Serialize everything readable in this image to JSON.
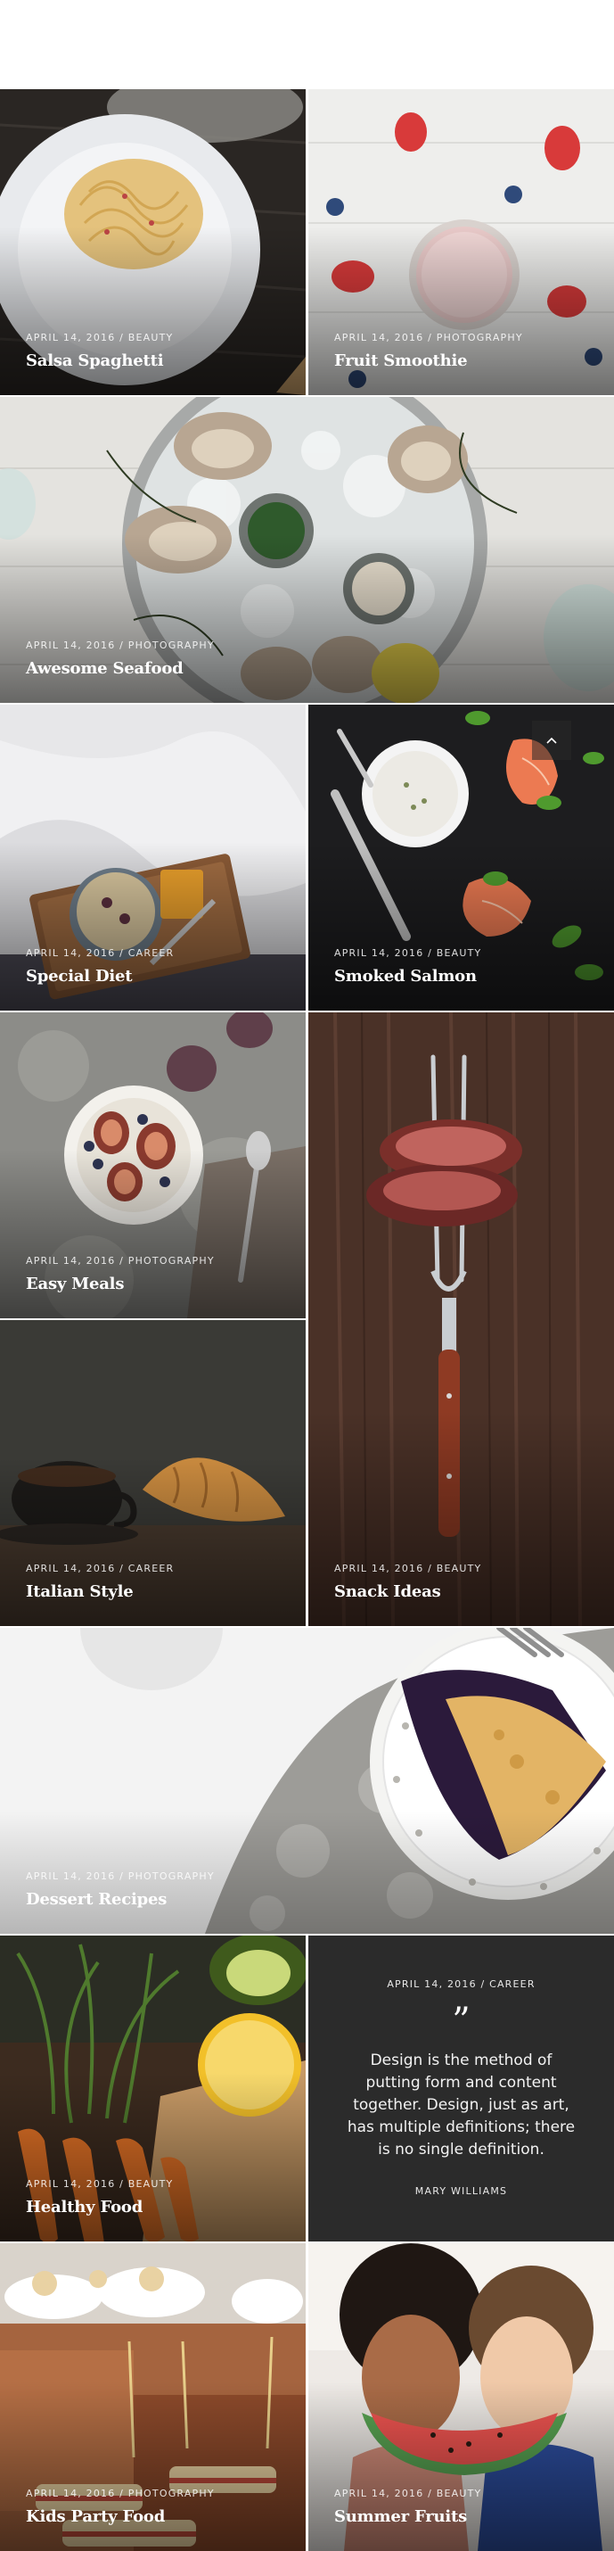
{
  "posts": [
    {
      "date_category": "APRIL 14, 2016 / BEAUTY",
      "title": "Salsa Spaghetti"
    },
    {
      "date_category": "APRIL 14, 2016 / PHOTOGRAPHY",
      "title": "Fruit Smoothie"
    },
    {
      "date_category": "APRIL 14, 2016 / PHOTOGRAPHY",
      "title": "Awesome Seafood"
    },
    {
      "date_category": "APRIL 14, 2016 / CAREER",
      "title": "Special Diet"
    },
    {
      "date_category": "APRIL 14, 2016 / BEAUTY",
      "title": "Smoked Salmon"
    },
    {
      "date_category": "APRIL 14, 2016 / PHOTOGRAPHY",
      "title": "Easy Meals"
    },
    {
      "date_category": "APRIL 14, 2016 / BEAUTY",
      "title": "Snack Ideas"
    },
    {
      "date_category": "APRIL 14, 2016 / CAREER",
      "title": "Italian Style"
    },
    {
      "date_category": "APRIL 14, 2016 / PHOTOGRAPHY",
      "title": "Dessert Recipes"
    },
    {
      "date_category": "APRIL 14, 2016 / BEAUTY",
      "title": "Healthy Food"
    },
    {
      "date_category": "APRIL 14, 2016 / PHOTOGRAPHY",
      "title": "Kids Party Food"
    },
    {
      "date_category": "APRIL 14, 2016 / BEAUTY",
      "title": "Summer Fruits"
    }
  ],
  "quote_post": {
    "date_category": "APRIL 14, 2016 / CAREER",
    "mark": "”",
    "text": "Design is the method of putting form and content together. Design, just as art, has multiple definitions; there is no single definition.",
    "author": "MARY WILLIAMS"
  },
  "scroll_top": {
    "icon": "chevron-up-icon"
  },
  "colors": {
    "quote_bg": "#2b2b2b",
    "overlay": "#000000",
    "text": "#ffffff"
  }
}
